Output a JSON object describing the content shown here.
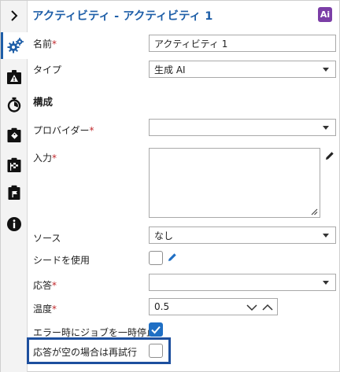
{
  "header": {
    "title": "アクティビティ - アクティビティ 1",
    "ai_badge": "Ai"
  },
  "sidebar": {
    "items": [
      {
        "name": "expand",
        "icon": "chevron-right-icon"
      },
      {
        "name": "settings",
        "icon": "gears-icon",
        "active": true
      },
      {
        "name": "warning",
        "icon": "warning-icon"
      },
      {
        "name": "timer",
        "icon": "stopwatch-icon"
      },
      {
        "name": "tag",
        "icon": "tag-clipboard-icon"
      },
      {
        "name": "flag",
        "icon": "checkered-flag-icon"
      },
      {
        "name": "assignment",
        "icon": "clipboard-flag-icon"
      },
      {
        "name": "info",
        "icon": "info-icon"
      }
    ]
  },
  "form": {
    "name": {
      "label": "名前",
      "required": "*",
      "value": "アクティビティ 1"
    },
    "type": {
      "label": "タイプ",
      "value": "生成 AI"
    },
    "section_title": "構成",
    "provider": {
      "label": "プロバイダー",
      "required": "*",
      "value": ""
    },
    "input": {
      "label": "入力",
      "required": "*",
      "value": ""
    },
    "source": {
      "label": "ソース",
      "value": "なし"
    },
    "use_seed": {
      "label": "シードを使用",
      "checked": false
    },
    "response": {
      "label": "応答",
      "required": "*",
      "value": ""
    },
    "temperature": {
      "label": "温度",
      "required": "*",
      "value": "0.5"
    },
    "pause_on_error": {
      "label": "エラー時にジョブを一時停止",
      "checked": true
    },
    "retry_if_empty": {
      "label": "応答が空の場合は再試行",
      "checked": false
    }
  },
  "colors": {
    "accent": "#1f5fa8",
    "checkbox": "#1f6fc4",
    "required": "#c0282c",
    "ai_badge": "#7b3ea6",
    "highlight": "#1d4f9e"
  }
}
